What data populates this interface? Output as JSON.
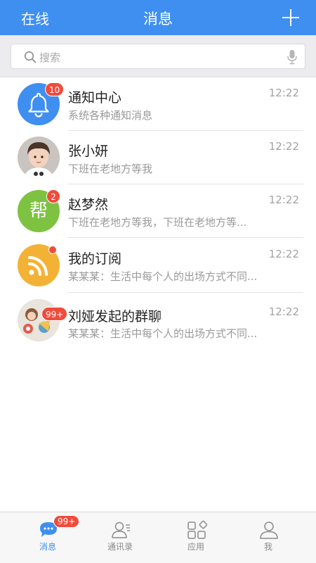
{
  "header": {
    "left_label": "在线",
    "title": "消息"
  },
  "search": {
    "placeholder": "搜索"
  },
  "conversations": [
    {
      "name": "通知中心",
      "preview": "系统各种通知消息",
      "time": "12:22",
      "badge": "10",
      "avatar_text": ""
    },
    {
      "name": "张小妍",
      "preview": "下班在老地方等我",
      "time": "12:22",
      "badge": "",
      "avatar_text": ""
    },
    {
      "name": "赵梦然",
      "preview": "下班在老地方等我，下班在老地方等...",
      "time": "12:22",
      "badge": "2",
      "avatar_text": "帮"
    },
    {
      "name": "我的订阅",
      "preview": "某某某：生活中每个人的出场方式不同...",
      "time": "12:22",
      "badge": "",
      "avatar_text": ""
    },
    {
      "name": "刘娅发起的群聊",
      "preview": "某某某：生活中每个人的出场方式不同...",
      "time": "12:22",
      "badge": "99+",
      "avatar_text": ""
    }
  ],
  "tabs": [
    {
      "label": "消息",
      "badge": "99+",
      "active": true,
      "icon": "chat-bubble-icon"
    },
    {
      "label": "通讯录",
      "active": false,
      "icon": "contacts-icon"
    },
    {
      "label": "应用",
      "active": false,
      "icon": "apps-icon"
    },
    {
      "label": "我",
      "active": false,
      "icon": "person-icon"
    }
  ],
  "colors": {
    "primary": "#3e8ff0",
    "badge": "#f24a3b",
    "notify_avatar": "#3e8ff0",
    "group_avatar": "#7ec242",
    "rss_avatar": "#f3b236"
  }
}
